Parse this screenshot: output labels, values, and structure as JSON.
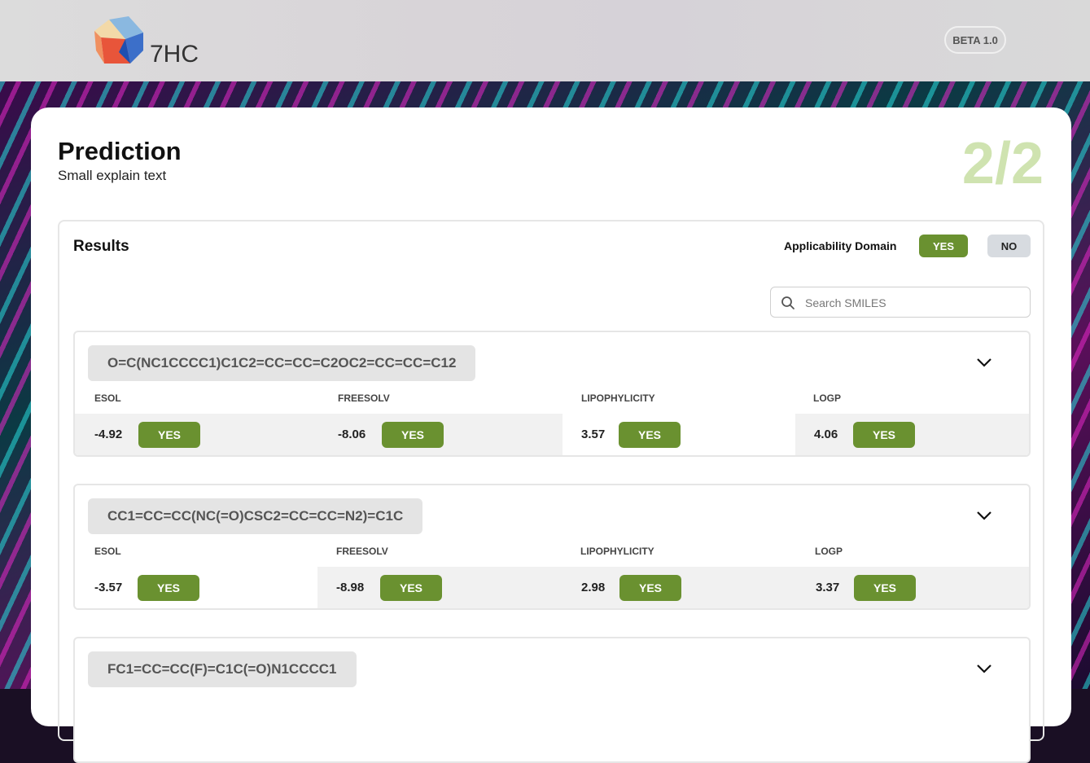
{
  "header": {
    "logo_text": "7HC",
    "badge": "BETA 1.0"
  },
  "page": {
    "title": "Prediction",
    "subtitle": "Small explain text",
    "step": "2/2"
  },
  "results": {
    "title": "Results",
    "applicability_domain_label": "Applicability Domain",
    "ad_yes": "YES",
    "ad_no": "NO",
    "search_placeholder": "Search SMILES",
    "properties": [
      "ESOL",
      "FREESOLV",
      "LIPOPHYLICITY",
      "LOGP"
    ],
    "entries": [
      {
        "smiles": "O=C(NC1CCCC1)C1C2=CC=CC=C2OC2=CC=CC=C12",
        "values": [
          "-4.92",
          "-8.06",
          "3.57",
          "4.06"
        ],
        "domain": [
          "YES",
          "YES",
          "YES",
          "YES"
        ]
      },
      {
        "smiles": "CC1=CC=CC(NC(=O)CSC2=CC=CC=N2)=C1C",
        "values": [
          "-3.57",
          "-8.98",
          "2.98",
          "3.37"
        ],
        "domain": [
          "YES",
          "YES",
          "YES",
          "YES"
        ]
      },
      {
        "smiles": "FC1=CC=CC(F)=C1C(=O)N1CCCC1"
      }
    ]
  },
  "colors": {
    "accent_green": "#6a9130",
    "step_green": "#cfe3b0",
    "no_gray": "#d7dbe0"
  },
  "icons": {
    "search": "search-icon",
    "expand": "chevron-down-icon",
    "logo": "hexagon-logo-icon"
  }
}
